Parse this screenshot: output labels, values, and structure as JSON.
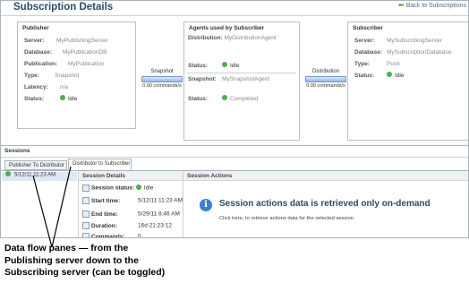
{
  "page": {
    "title": "Subscription Details",
    "back_link": "Back to Subscriptions"
  },
  "publisher": {
    "title": "Publisher",
    "fields": [
      {
        "key": "Server:",
        "value": "MyPublishingServer"
      },
      {
        "key": "Database:",
        "value": "MyPublicationDB"
      },
      {
        "key": "Publication:",
        "value": "MyPublication"
      },
      {
        "key": "Type:",
        "value": "Snapshot"
      },
      {
        "key": "Latency:",
        "value": "n/a"
      },
      {
        "key": "Status:",
        "value": "Idle"
      }
    ]
  },
  "flow_left": {
    "label": "Snapshot",
    "rate": "0.00 commands/s"
  },
  "agents": {
    "title": "Agents used by Subscriber",
    "distribution_key": "Distribution:",
    "distribution_value": "MyDistributionAgent",
    "status1_key": "Status:",
    "status1_value": "Idle",
    "snapshot_key": "Snapshot:",
    "snapshot_value": "MySnapshotAgent",
    "status2_key": "Status:",
    "status2_value": "Completed"
  },
  "flow_right": {
    "label": "Distribution",
    "rate": "0.00 commands/s"
  },
  "subscriber": {
    "title": "Subscriber",
    "fields": [
      {
        "key": "Server:",
        "value": "MySubscribingServer"
      },
      {
        "key": "Database:",
        "value": "MySubscriptionDatabase"
      },
      {
        "key": "Type:",
        "value": "Push"
      },
      {
        "key": "Status:",
        "value": "Idle"
      }
    ]
  },
  "sessions": {
    "header": "Sessions",
    "tabs": [
      "Publisher To Distributor",
      "Distributor to Subscriber"
    ],
    "active_tab": 1,
    "list": [
      {
        "time": "5/12/11 11:23 AM"
      }
    ]
  },
  "session_details": {
    "header": "Session Details",
    "rows": [
      {
        "key": "Session status:",
        "value": "Idle",
        "status_dot": true
      },
      {
        "key": "Start time:",
        "value": "5/12/11 11:23 AM"
      },
      {
        "key": "End time:",
        "value": "5/29/11 8:46 AM"
      },
      {
        "key": "Duration:",
        "value": "16d 21:23:12"
      },
      {
        "key": "Commands:",
        "value": "0"
      }
    ]
  },
  "session_actions": {
    "header": "Session Actions",
    "title": "Session actions data is retrieved only on-demand",
    "link_text": "Click here, to retrieve actions data for the selected session."
  },
  "caption": {
    "line1": "Data flow panes — from the",
    "line2": "Publishing server down to the",
    "line3": "Subscribing server (can be toggled)"
  },
  "colors": {
    "accent": "#2c4a6b",
    "ok": "#4caf50",
    "info": "#3d7fd0"
  }
}
